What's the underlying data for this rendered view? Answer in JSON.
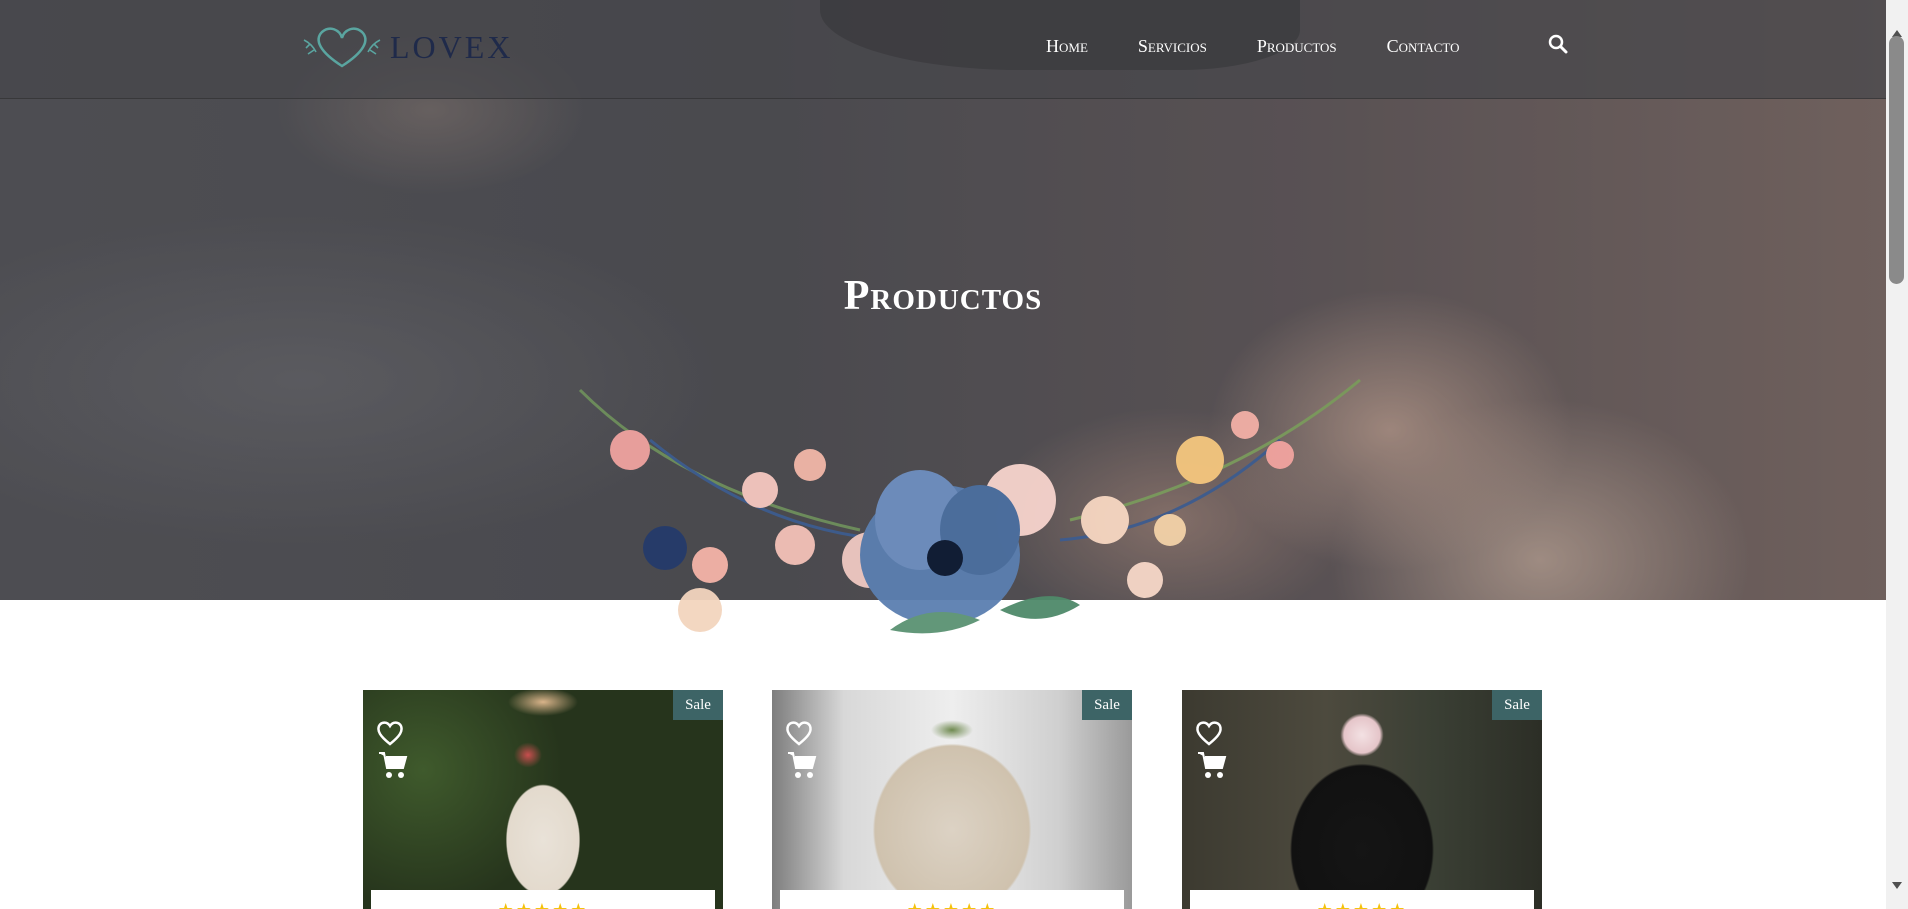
{
  "brand": {
    "name": "LOVEX"
  },
  "nav": {
    "items": [
      {
        "label": "Home"
      },
      {
        "label": "Servicios"
      },
      {
        "label": "Productos"
      },
      {
        "label": "Contacto"
      }
    ],
    "search_icon": "search-icon"
  },
  "hero": {
    "title": "Productos"
  },
  "products": [
    {
      "badge": "Sale",
      "rating": 5,
      "wishlist_icon": "heart-icon",
      "cart_icon": "cart-icon"
    },
    {
      "badge": "Sale",
      "rating": 5,
      "wishlist_icon": "heart-icon",
      "cart_icon": "cart-icon"
    },
    {
      "badge": "Sale",
      "rating": 5,
      "wishlist_icon": "heart-icon",
      "cart_icon": "cart-icon"
    }
  ],
  "colors": {
    "badge": "#3d6466",
    "logo_text": "#1f2a4a",
    "logo_accent": "#5aa5a0",
    "stars": "#f4c20d"
  }
}
